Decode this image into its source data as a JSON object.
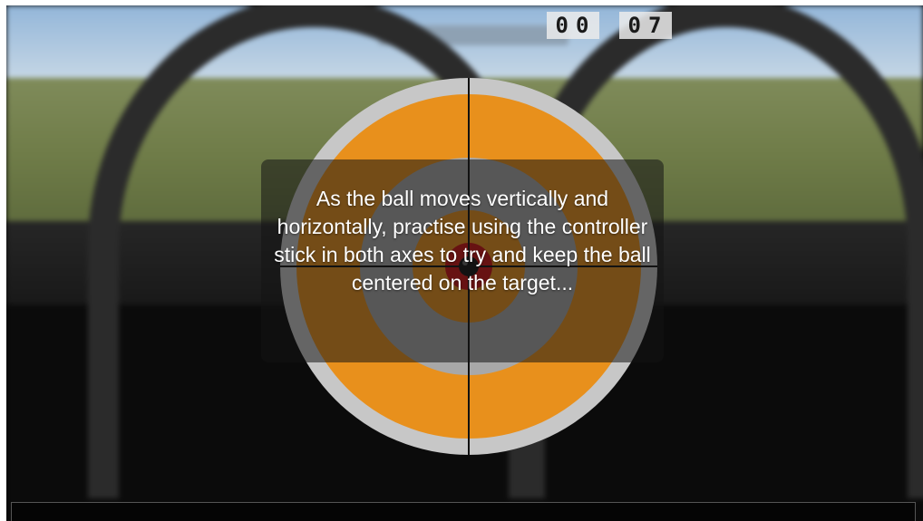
{
  "timer": {
    "minutes": "00",
    "seconds": "07"
  },
  "message": "As the ball moves vertically and horizontally, practise using the controller stick in both axes to try and keep the ball centered on the target...",
  "target": {
    "ring_colors": [
      "#c7c7c7",
      "#e8901c",
      "#a8a8a8",
      "#e8901c",
      "#cc1010"
    ],
    "ball_color": "#111111",
    "crosshair_color": "#111111"
  }
}
